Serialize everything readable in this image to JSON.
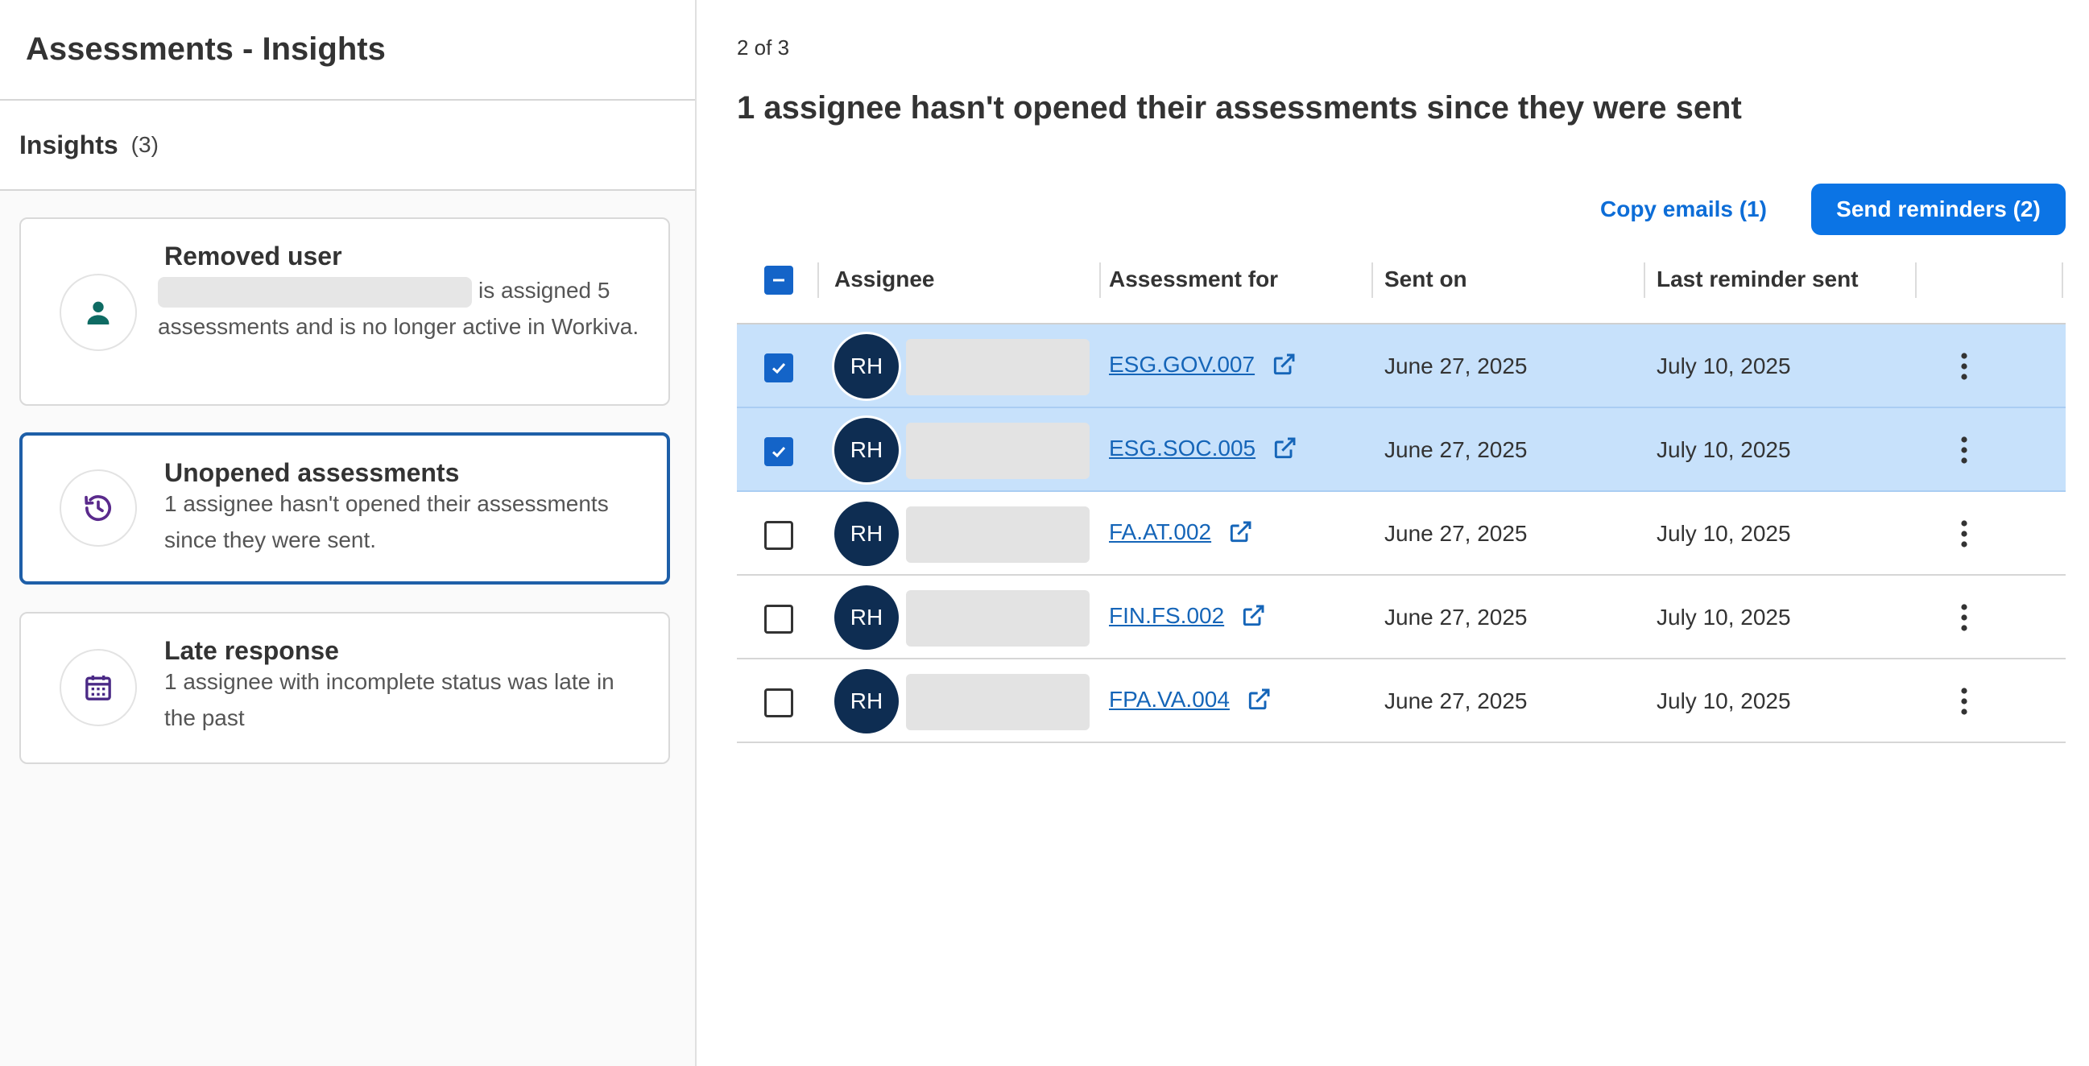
{
  "app": {
    "title": "Assessments - Insights"
  },
  "sidebar": {
    "insights_label": "Insights",
    "insights_count": "(3)",
    "cards": [
      {
        "icon": "person-icon",
        "title": "Removed user",
        "text": "is assigned 5 assessments and is no longer active in Workiva.",
        "selected": false
      },
      {
        "icon": "history-icon",
        "title": "Unopened assessments",
        "text": "1 assignee hasn't opened their assessments since they were sent.",
        "selected": true
      },
      {
        "icon": "calendar-icon",
        "title": "Late response",
        "text": "1 assignee with incomplete status was late in the past",
        "selected": false
      }
    ]
  },
  "main": {
    "pager": "2 of 3",
    "title": "1 assignee hasn't opened their assessments since they were sent",
    "copy_emails_label": "Copy emails (1)",
    "send_reminders_label": "Send reminders (2)",
    "columns": [
      "Assignee",
      "Assessment for",
      "Sent on",
      "Last reminder sent"
    ],
    "rows": [
      {
        "initials": "RH",
        "assessment": "ESG.GOV.007",
        "sent_on": "June 27, 2025",
        "last_reminder": "July 10, 2025",
        "checked": true
      },
      {
        "initials": "RH",
        "assessment": "ESG.SOC.005",
        "sent_on": "June 27, 2025",
        "last_reminder": "July 10, 2025",
        "checked": true
      },
      {
        "initials": "RH",
        "assessment": "FA.AT.002",
        "sent_on": "June 27, 2025",
        "last_reminder": "July 10, 2025",
        "checked": false
      },
      {
        "initials": "RH",
        "assessment": "FIN.FS.002",
        "sent_on": "June 27, 2025",
        "last_reminder": "July 10, 2025",
        "checked": false
      },
      {
        "initials": "RH",
        "assessment": "FPA.VA.004",
        "sent_on": "June 27, 2025",
        "last_reminder": "July 10, 2025",
        "checked": false
      }
    ]
  },
  "colors": {
    "accent": "#0b74e5",
    "selected_row": "#c7e1fb",
    "avatar_bg": "#0e2d52",
    "link": "#1565b8",
    "person_icon": "#0e6b63",
    "history_icon": "#5a2a8c",
    "calendar_icon": "#4b2a86"
  }
}
